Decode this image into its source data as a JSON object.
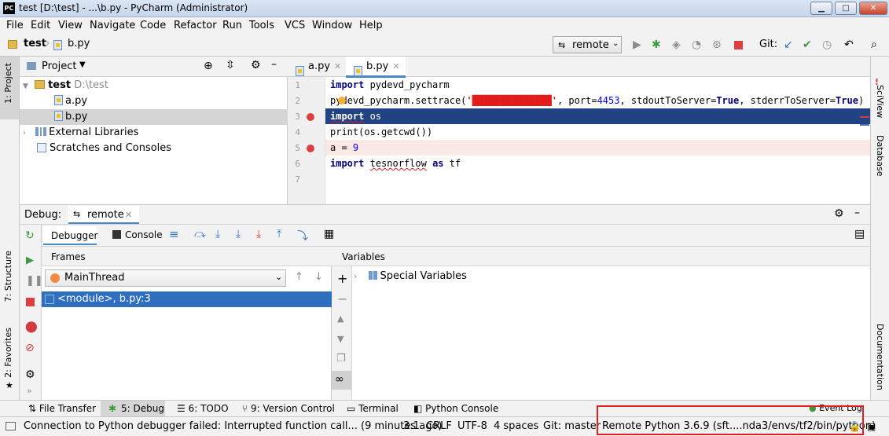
{
  "window": {
    "title": "test [D:\\test] - ...\\b.py - PyCharm (Administrator)",
    "app_icon": "PC",
    "minimize": "▁",
    "maximize": "□",
    "close": "✕"
  },
  "menu": [
    "File",
    "Edit",
    "View",
    "Navigate",
    "Code",
    "Refactor",
    "Run",
    "Tools",
    "VCS",
    "Window",
    "Help"
  ],
  "navbar": {
    "breadcrumb_project": "test",
    "breadcrumb_file": "b.py",
    "run_config": "remote",
    "git_label": "Git:"
  },
  "project": {
    "header": "Project",
    "root_name": "test",
    "root_path": "D:\\test",
    "files": [
      "a.py",
      "b.py"
    ],
    "external": "External Libraries",
    "scratches": "Scratches and Consoles"
  },
  "left_strip": {
    "project_tab": "1: Project",
    "structure_tab": "7: Structure",
    "favorites_tab": "2: Favorites"
  },
  "right_strip": {
    "sciview": "SciView",
    "database": "Database",
    "documentation": "Documentation"
  },
  "editor": {
    "tabs": [
      "a.py",
      "b.py"
    ],
    "line_numbers": [
      "1",
      "2",
      "3",
      "4",
      "5",
      "6",
      "7"
    ],
    "code": {
      "l1_kw": "import",
      "l1_rest": " pydevd_pycharm",
      "l2_a": "pydevd_pycharm.settrace(",
      "l2_str": "'██████████████'",
      "l2_b": ", port=",
      "l2_port": "4453",
      "l2_c": ", stdoutToServer=",
      "l2_t1": "True",
      "l2_d": ", stderrToServer=",
      "l2_t2": "True",
      "l2_e": ")",
      "l3_kw": "import",
      "l3_rest": " os",
      "l4": "print(os.getcwd())",
      "l5_a": "a = ",
      "l5_num": "9",
      "l6_kw1": "import",
      "l6_mod": "tesnorflow",
      "l6_kw2": "as",
      "l6_alias": "tf"
    }
  },
  "debug": {
    "label": "Debug:",
    "session": "remote",
    "debugger_tab": "Debugger",
    "console_tab": "Console",
    "frames_header": "Frames",
    "thread": "MainThread",
    "frame": "<module>, b.py:3",
    "variables_header": "Variables",
    "special_vars": "Special Variables"
  },
  "tool_tabs": {
    "file_transfer": "File Transfer",
    "debug": "5: Debug",
    "todo": "6: TODO",
    "version_control": "9: Version Control",
    "terminal": "Terminal",
    "python_console": "Python Console",
    "event_log": "Event Log"
  },
  "status": {
    "message": "Connection to Python debugger failed: Interrupted function call... (9 minutes ago)",
    "position": "3:1",
    "line_sep": "CRLF",
    "encoding": "UTF-8",
    "indent": "4 spaces",
    "git": "Git: master",
    "interpreter": "Remote Python 3.6.9 (sft....nda3/envs/tf2/bin/python)"
  },
  "colors": {
    "selection": "#2f6fc0",
    "current_line": "#214283",
    "breakpoint": "#db3f3f",
    "highlight_box": "#e0201e"
  }
}
